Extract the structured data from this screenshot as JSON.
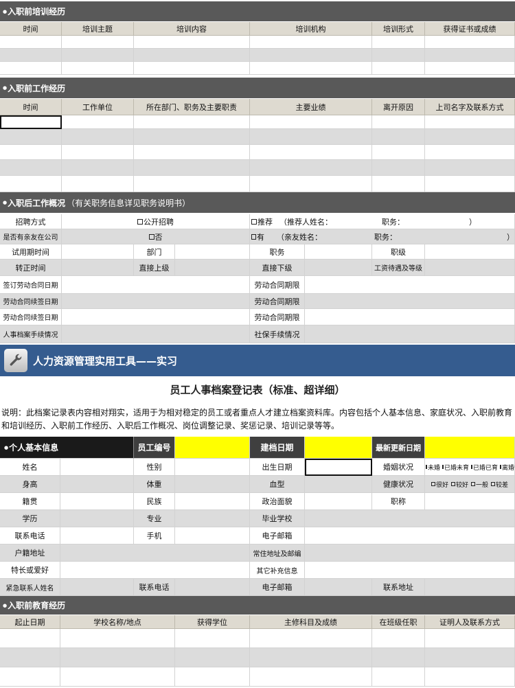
{
  "sec_pre_training": {
    "title": "入职前培训经历",
    "headers": [
      "时间",
      "培训主题",
      "培训内容",
      "培训机构",
      "培训形式",
      "获得证书或成绩"
    ]
  },
  "sec_pre_work": {
    "title": "入职前工作经历",
    "headers": [
      "时间",
      "工作单位",
      "所在部门、职务及主要职责",
      "主要业绩",
      "离开原因",
      "上司名字及联系方式"
    ]
  },
  "sec_post": {
    "title": "入职后工作概况",
    "note": "（有关职务信息详见职务说明书）",
    "recruit_label": "招聘方式",
    "recruit_open": "公开招聘",
    "recruit_ref": "推荐",
    "recruit_ref_name": "（推荐人姓名：",
    "recruit_ref_job": "职务：",
    "recruit_close": "）",
    "relatives_label": "是否有亲友在公司",
    "relatives_no": "否",
    "relatives_yes": "有",
    "relatives_name": "（亲友姓名：",
    "relatives_job": "职务：",
    "relatives_close": "）",
    "probation": "试用期时间",
    "dept": "部门",
    "position": "职务",
    "level": "职级",
    "regular_time": "转正时间",
    "direct_sup": "直接上级",
    "direct_sub": "直接下级",
    "salary": "工资待遇及等级",
    "contract_sign": "签订劳动合同日期",
    "contract_term": "劳动合同期限",
    "renew": "劳动合同续签日期",
    "archive": "人事档案手续情况",
    "social": "社保手续情况"
  },
  "banner": {
    "text": "人力资源管理实用工具——实习"
  },
  "form": {
    "title": "员工人事档案登记表（标准、超详细）",
    "description": "说明：此档案记录表内容相对翔实，适用于为相对稳定的员工或者重点人才建立档案资料库。内容包括个人基本信息、家庭状况、入职前教育和培训经历、入职前工作经历、入职后工作概况、岗位调整记录、奖惩记录、培训记录等等。"
  },
  "basic": {
    "title": "个人基本信息",
    "emp_id": "员工编号",
    "file_date": "建档日期",
    "update_date": "最新更新日期",
    "name": "姓名",
    "gender": "性别",
    "birth": "出生日期",
    "marital": "婚姻状况",
    "marital_opts": [
      "未婚",
      "已婚未育",
      "已婚已育",
      "离婚"
    ],
    "height": "身高",
    "weight": "体重",
    "blood": "血型",
    "health": "健康状况",
    "health_opts": [
      "很好",
      "较好",
      "一般",
      "较差"
    ],
    "native": "籍贯",
    "ethnic": "民族",
    "political": "政治面貌",
    "title_rank": "职称",
    "edu": "学历",
    "major": "专业",
    "school": "毕业学校",
    "phone": "联系电话",
    "mobile": "手机",
    "email": "电子邮箱",
    "hukou": "户籍地址",
    "residence": "常住地址及邮编",
    "hobby": "特长或爱好",
    "extra": "其它补充信息",
    "emergency": "紧急联系人姓名",
    "em_phone": "联系电话",
    "em_email": "电子邮箱",
    "em_addr": "联系地址"
  },
  "sec_edu": {
    "title": "入职前教育经历",
    "headers": [
      "起止日期",
      "学校名称/地点",
      "获得学位",
      "主修科目及成绩",
      "在班级任职",
      "证明人及联系方式"
    ]
  },
  "colors": {
    "section": "#595959",
    "header": "#dedad0",
    "gray_row": "#dcdcdc",
    "banner": "#355c8f",
    "highlight": "#ffff00"
  }
}
